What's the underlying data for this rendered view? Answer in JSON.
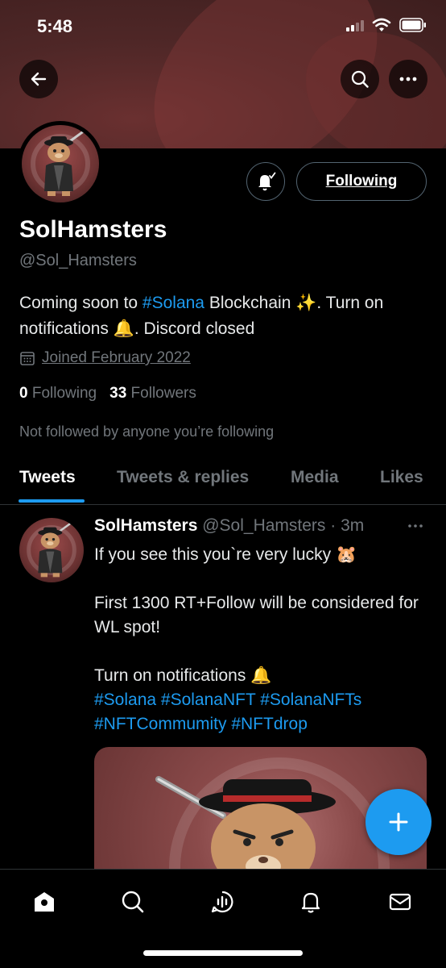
{
  "status_bar": {
    "time": "5:48"
  },
  "profile": {
    "name": "SolHamsters",
    "handle": "@Sol_Hamsters",
    "bio": {
      "part1": "Coming soon to ",
      "hashtag": "#Solana",
      "part2": " Blockchain ✨. Turn on notifications 🔔. Discord closed"
    },
    "joined": "Joined February 2022",
    "following_count": "0",
    "following_label": "Following",
    "followers_count": "33",
    "followers_label": "Followers",
    "not_followed": "Not followed by anyone you’re following",
    "following_button": "Following"
  },
  "tabs": [
    {
      "label": "Tweets",
      "active": true
    },
    {
      "label": "Tweets & replies"
    },
    {
      "label": "Media"
    },
    {
      "label": "Likes"
    }
  ],
  "tweet": {
    "name": "SolHamsters",
    "handle": "@Sol_Hamsters",
    "time": "· 3m",
    "line1": "If you see this you`re very lucky 🐹",
    "line2": "First 1300 RT+Follow will be considered for WL spot!",
    "line3": "Turn on notifications 🔔",
    "hashtags_line1": "#Solana #SolanaNFT #SolanaNFTs",
    "hashtags_line2": "#NFTCommumity #NFTdrop"
  },
  "colors": {
    "accent": "#1d9bf0",
    "background": "#000000",
    "muted": "#71767b"
  }
}
